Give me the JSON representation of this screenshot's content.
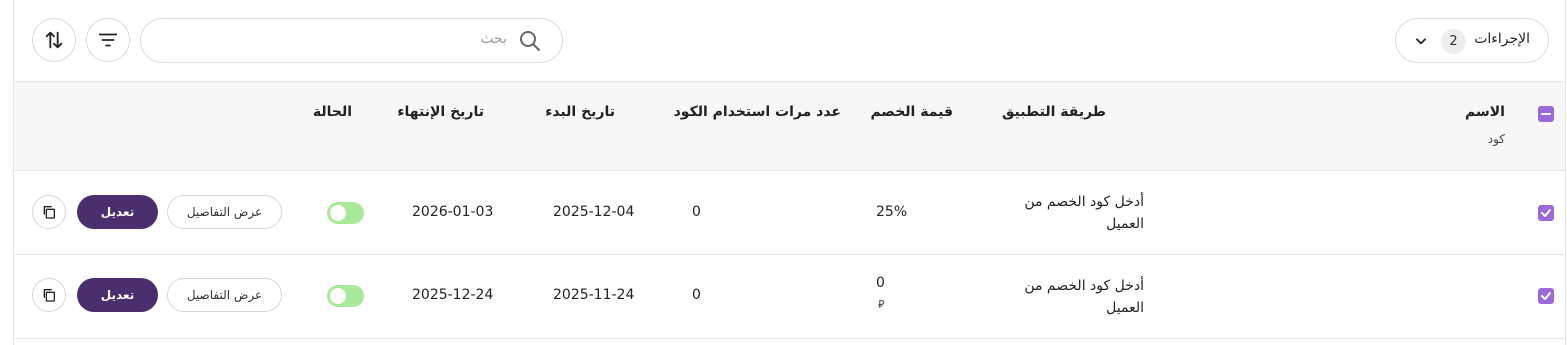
{
  "toolbar": {
    "actions_label": "الإجراءات",
    "actions_count": "2",
    "search_placeholder": "بحث"
  },
  "table": {
    "headers": {
      "name": "الاسم",
      "name_sub": "كود",
      "method": "طريقة التطبيق",
      "discount": "قيمة الخصم",
      "uses": "عدد مرات استخدام الكود",
      "start": "تاريخ البدء",
      "end": "تاريخ الإنتهاء",
      "status": "الحالة"
    },
    "rows": [
      {
        "method": "أدخل كود الخصم من العميل",
        "discount": "25%",
        "discount_unit": "",
        "uses": "0",
        "start": "2025-12-04",
        "end": "2026-01-03",
        "status_on": true,
        "details_label": "عرض التفاصيل",
        "edit_label": "تعديل"
      },
      {
        "method": "أدخل كود الخصم من العميل",
        "discount": "0",
        "discount_unit": "⃁",
        "uses": "0",
        "start": "2025-11-24",
        "end": "2025-12-24",
        "status_on": true,
        "details_label": "عرض التفاصيل",
        "edit_label": "تعديل"
      }
    ]
  },
  "colors": {
    "accent_purple": "#9b6ad8",
    "edit_button": "#4a2f6e",
    "toggle_on": "#a9ea9a"
  }
}
